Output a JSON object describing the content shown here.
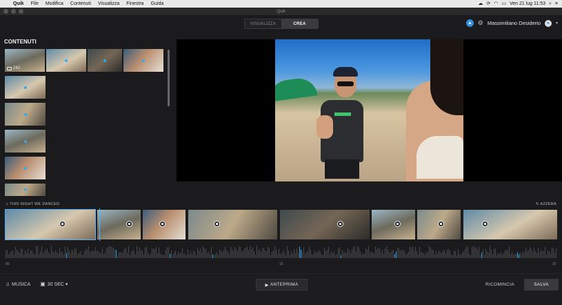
{
  "menubar": {
    "app": "Quik",
    "items": [
      "File",
      "Modifica",
      "Contenuti",
      "Visualizza",
      "Finestra",
      "Guida"
    ],
    "clock": "Ven 21 lug  11:53"
  },
  "window": {
    "title": "Quik"
  },
  "header": {
    "tabs": [
      {
        "label": "VISUALIZZA",
        "active": false
      },
      {
        "label": "CREA",
        "active": true
      }
    ],
    "user_name": "Massimiliano Desiderio"
  },
  "content_panel": {
    "title": "CONTENUTI",
    "media_count": "242"
  },
  "music": {
    "track": "THIS NIGHT WE DANCED",
    "reset_label": "AZZERA"
  },
  "time_ruler": {
    "labels": [
      "00",
      "15",
      "30"
    ]
  },
  "footer": {
    "music_label": "MUSICA",
    "duration_label": "30 SEC",
    "preview_label": "ANTEPRIMA",
    "restart_label": "RICOMINCIA",
    "save_label": "SALVA"
  },
  "colors": {
    "accent": "#35a9f0",
    "background": "#1b1b1d"
  }
}
